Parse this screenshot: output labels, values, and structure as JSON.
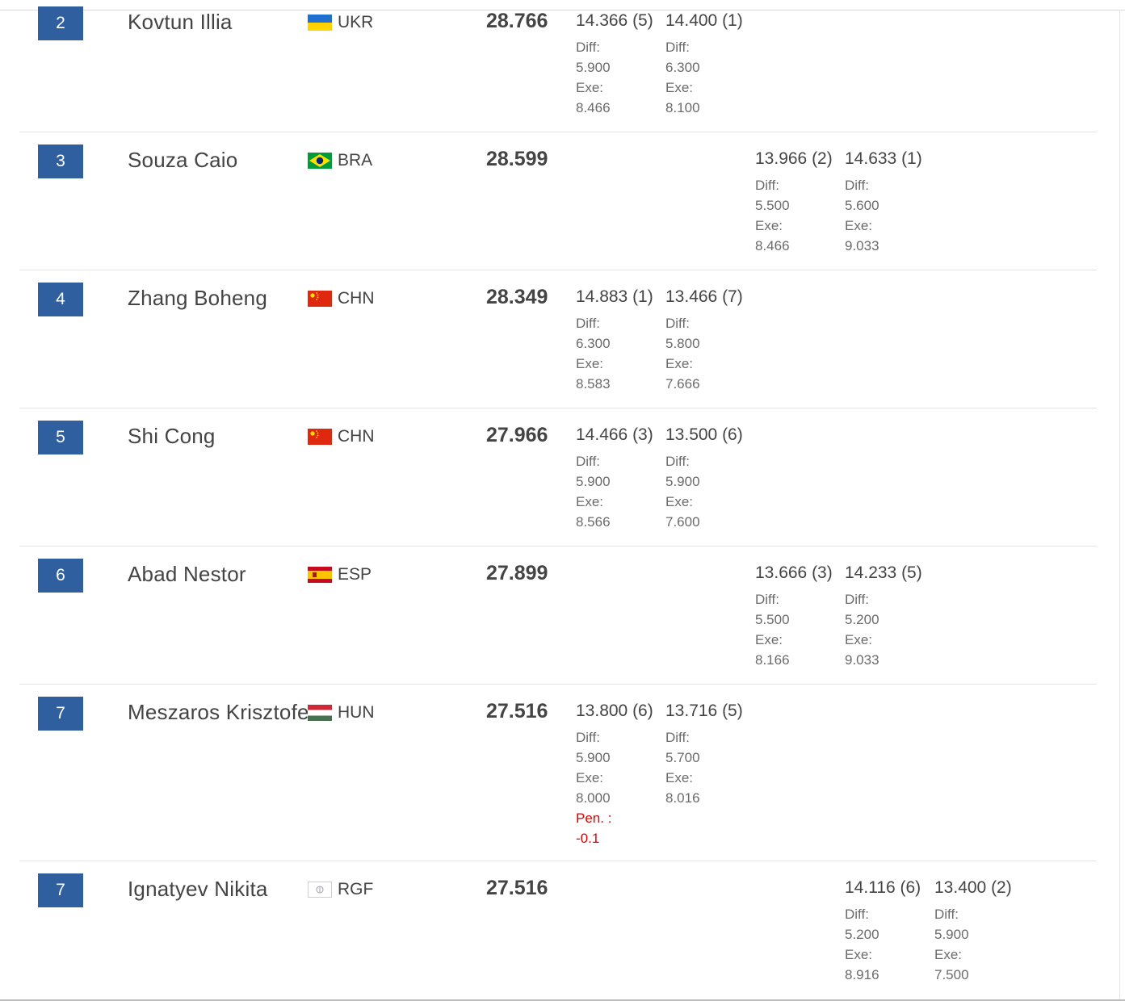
{
  "labels": {
    "diff": "Diff:",
    "exe": "Exe:",
    "pen": "Pen. :"
  },
  "colors": {
    "rank_badge": "#2f5f9e",
    "penalty": "#e00000",
    "text": "#444444"
  },
  "rows": [
    {
      "rank": "2",
      "name": "Kovtun Illia",
      "flag_icon": "ukraine-flag-icon",
      "nat": "UKR",
      "total": "28.766",
      "apps": [
        {
          "score": "14.366 (5)",
          "diff": "5.900",
          "exe": "8.466"
        },
        {
          "score": "14.400 (1)",
          "diff": "6.300",
          "exe": "8.100"
        }
      ]
    },
    {
      "rank": "3",
      "name": "Souza Caio",
      "flag_icon": "brazil-flag-icon",
      "nat": "BRA",
      "total": "28.599",
      "apps": [
        {
          "score": "13.966 (2)",
          "diff": "5.500",
          "exe": "8.466"
        },
        {
          "score": "14.633 (1)",
          "diff": "5.600",
          "exe": "9.033"
        }
      ]
    },
    {
      "rank": "4",
      "name": "Zhang Boheng",
      "flag_icon": "china-flag-icon",
      "nat": "CHN",
      "total": "28.349",
      "apps": [
        {
          "score": "14.883 (1)",
          "diff": "6.300",
          "exe": "8.583"
        },
        {
          "score": "13.466 (7)",
          "diff": "5.800",
          "exe": "7.666"
        }
      ]
    },
    {
      "rank": "5",
      "name": "Shi Cong",
      "flag_icon": "china-flag-icon",
      "nat": "CHN",
      "total": "27.966",
      "apps": [
        {
          "score": "14.466 (3)",
          "diff": "5.900",
          "exe": "8.566"
        },
        {
          "score": "13.500 (6)",
          "diff": "5.900",
          "exe": "7.600"
        }
      ]
    },
    {
      "rank": "6",
      "name": "Abad Nestor",
      "flag_icon": "spain-flag-icon",
      "nat": "ESP",
      "total": "27.899",
      "apps": [
        {
          "score": "13.666 (3)",
          "diff": "5.500",
          "exe": "8.166"
        },
        {
          "score": "14.233 (5)",
          "diff": "5.200",
          "exe": "9.033"
        }
      ]
    },
    {
      "rank": "7",
      "name": "Meszaros Krisztofer",
      "flag_icon": "hungary-flag-icon",
      "nat": "HUN",
      "total": "27.516",
      "apps": [
        {
          "score": "13.800 (6)",
          "diff": "5.900",
          "exe": "8.000",
          "pen": "-0.1"
        },
        {
          "score": "13.716 (5)",
          "diff": "5.700",
          "exe": "8.016"
        }
      ]
    },
    {
      "rank": "7",
      "name": "Ignatyev Nikita",
      "flag_icon": "rgf-flag-icon",
      "nat": "RGF",
      "total": "27.516",
      "apps": [
        {
          "score": "14.116 (6)",
          "diff": "5.200",
          "exe": "8.916"
        },
        {
          "score": "13.400 (2)",
          "diff": "5.900",
          "exe": "7.500"
        }
      ]
    }
  ]
}
